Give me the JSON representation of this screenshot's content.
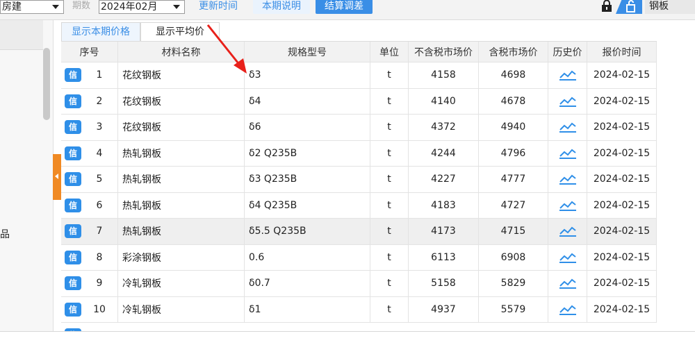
{
  "toolbar": {
    "category_select": "房建",
    "period_label": "期数",
    "period_select": "2024年02月",
    "update_time_button": "更新时间",
    "period_notes_button": "本期说明",
    "settlement_adjust_button": "结算调差",
    "search_value": "钢板"
  },
  "sidebar": {
    "partial_text": "品"
  },
  "tabs": [
    "显示本期价格",
    "显示平均价"
  ],
  "table": {
    "columns": [
      "序号",
      "材料名称",
      "规格型号",
      "单位",
      "不含税市场价",
      "含税市场价",
      "历史价",
      "报价时间"
    ],
    "badge_label": "信",
    "rows": [
      {
        "no": "1",
        "name": "花纹钢板",
        "spec": "δ3",
        "unit": "t",
        "price_ex_tax": "4158",
        "price_inc_tax": "4698",
        "date": "2024-02-15"
      },
      {
        "no": "2",
        "name": "花纹钢板",
        "spec": "δ4",
        "unit": "t",
        "price_ex_tax": "4140",
        "price_inc_tax": "4678",
        "date": "2024-02-15"
      },
      {
        "no": "3",
        "name": "花纹钢板",
        "spec": "δ6",
        "unit": "t",
        "price_ex_tax": "4372",
        "price_inc_tax": "4940",
        "date": "2024-02-15"
      },
      {
        "no": "4",
        "name": "热轧钢板",
        "spec": "δ2 Q235B",
        "unit": "t",
        "price_ex_tax": "4244",
        "price_inc_tax": "4796",
        "date": "2024-02-15"
      },
      {
        "no": "5",
        "name": "热轧钢板",
        "spec": "δ3 Q235B",
        "unit": "t",
        "price_ex_tax": "4227",
        "price_inc_tax": "4777",
        "date": "2024-02-15"
      },
      {
        "no": "6",
        "name": "热轧钢板",
        "spec": "δ4 Q235B",
        "unit": "t",
        "price_ex_tax": "4183",
        "price_inc_tax": "4727",
        "date": "2024-02-15"
      },
      {
        "no": "7",
        "name": "热轧钢板",
        "spec": "δ5.5 Q235B",
        "unit": "t",
        "price_ex_tax": "4173",
        "price_inc_tax": "4715",
        "date": "2024-02-15"
      },
      {
        "no": "8",
        "name": "彩涂钢板",
        "spec": "0.6",
        "unit": "t",
        "price_ex_tax": "6113",
        "price_inc_tax": "6908",
        "date": "2024-02-15"
      },
      {
        "no": "9",
        "name": "冷轧钢板",
        "spec": "δ0.7",
        "unit": "t",
        "price_ex_tax": "5158",
        "price_inc_tax": "5829",
        "date": "2024-02-15"
      },
      {
        "no": "10",
        "name": "冷轧钢板",
        "spec": "δ1",
        "unit": "t",
        "price_ex_tax": "4937",
        "price_inc_tax": "5579",
        "date": "2024-02-15"
      }
    ]
  },
  "colors": {
    "accent": "#3a8ee6",
    "badge": "#2f8fe8",
    "handle": "#f08a24",
    "arrow": "#e8201a"
  }
}
